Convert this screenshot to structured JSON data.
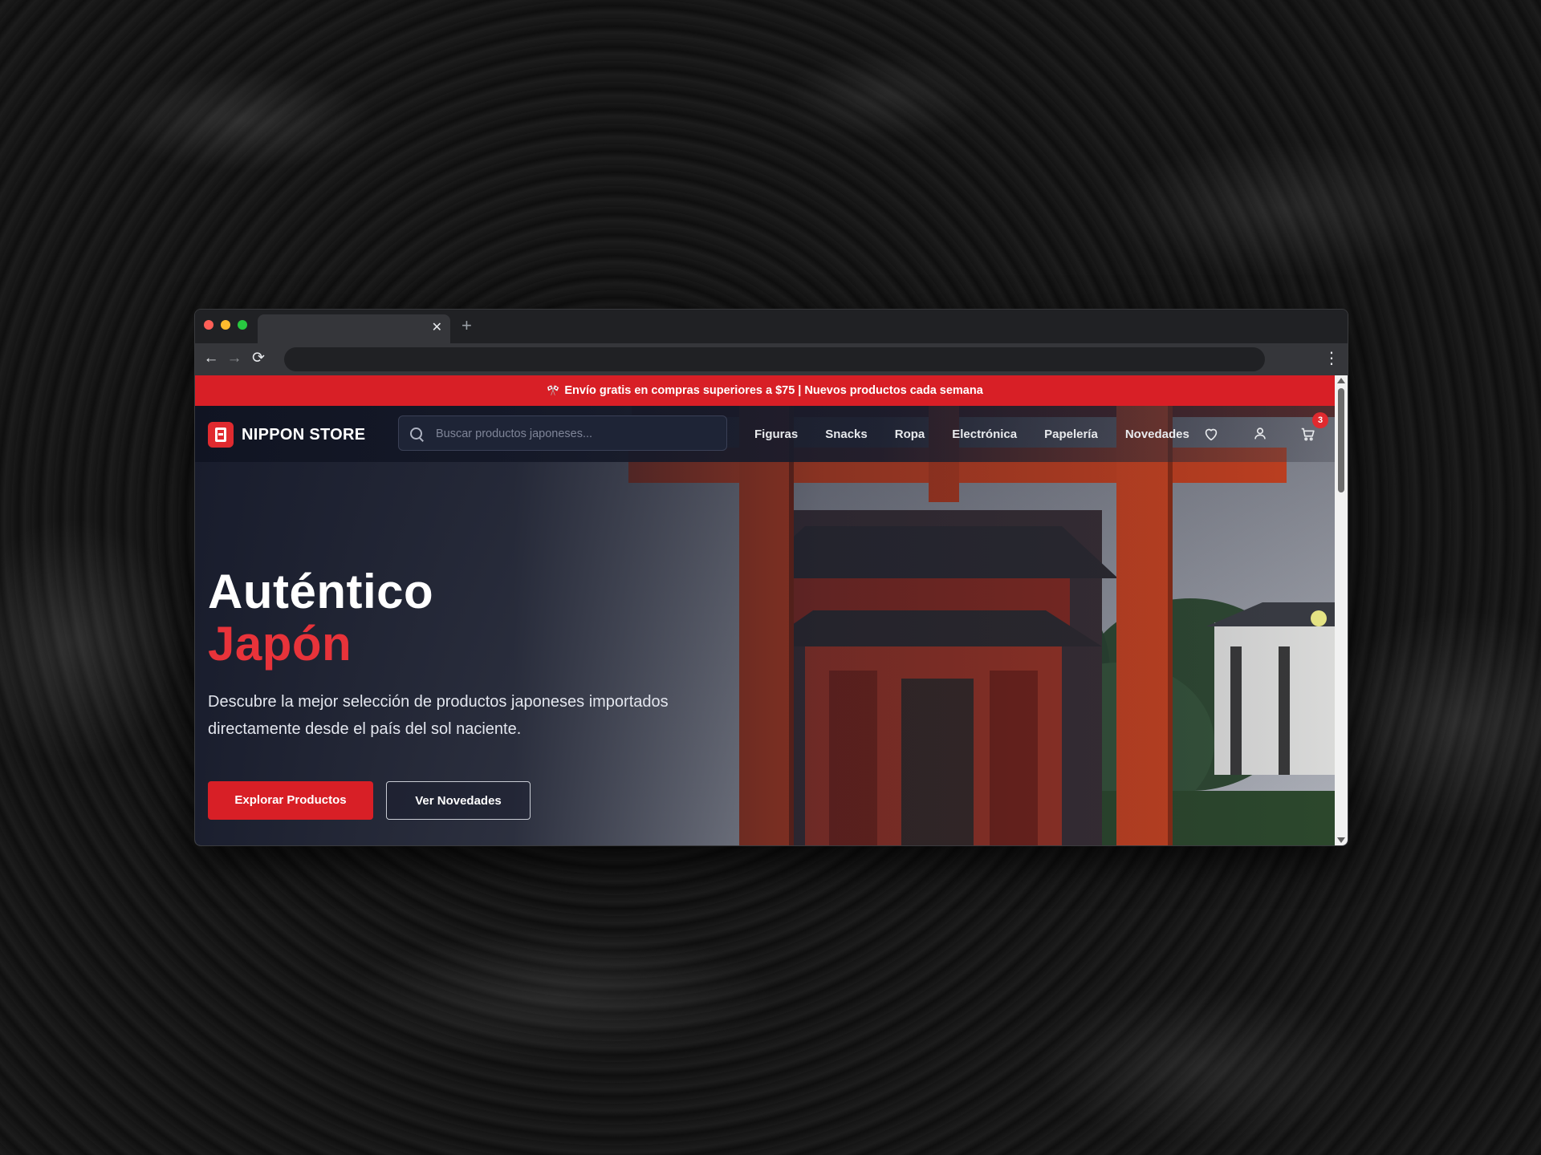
{
  "browser": {
    "new_tab_glyph": "+",
    "tab_close_glyph": "✕",
    "back_glyph": "←",
    "forward_glyph": "→",
    "reload_glyph": "⟳",
    "menu_glyph": "⋮"
  },
  "promo": {
    "icon": "🎌",
    "text": "Envío gratis en compras superiores a $75 | Nuevos productos cada semana"
  },
  "header": {
    "brand": "NIPPON STORE",
    "search_placeholder": "Buscar productos japoneses...",
    "nav": [
      "Figuras",
      "Snacks",
      "Ropa",
      "Electrónica",
      "Papelería",
      "Novedades"
    ],
    "cart_count": "3"
  },
  "hero": {
    "title_line1": "Auténtico",
    "title_line2": "Japón",
    "description": "Descubre la mejor selección de productos japoneses importados directamente desde el país del sol naciente.",
    "primary_button": "Explorar Productos",
    "secondary_button": "Ver Novedades"
  },
  "colors": {
    "accent": "#d81f26",
    "accent_text": "#e8333a",
    "hero_bg": "#1a1d27"
  }
}
